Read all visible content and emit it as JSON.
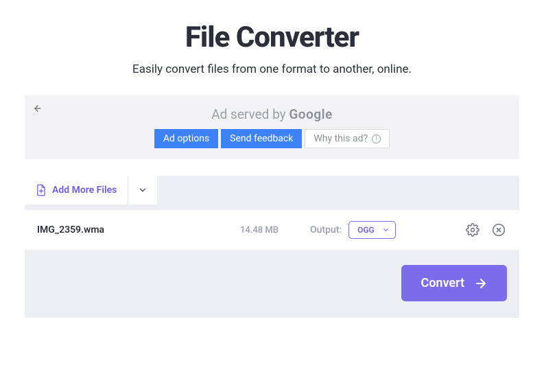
{
  "header": {
    "title": "File Converter",
    "subtitle": "Easily convert files from one format to another, online."
  },
  "ad": {
    "served_prefix": "Ad served by ",
    "served_brand": "Google",
    "options_label": "Ad options",
    "feedback_label": "Send feedback",
    "why_label": "Why this ad?"
  },
  "toolbar": {
    "add_label": "Add More Files"
  },
  "file": {
    "name": "IMG_2359.wma",
    "size": "14.48 MB",
    "output_label": "Output:",
    "output_value": "OGG"
  },
  "actions": {
    "convert_label": "Convert"
  }
}
